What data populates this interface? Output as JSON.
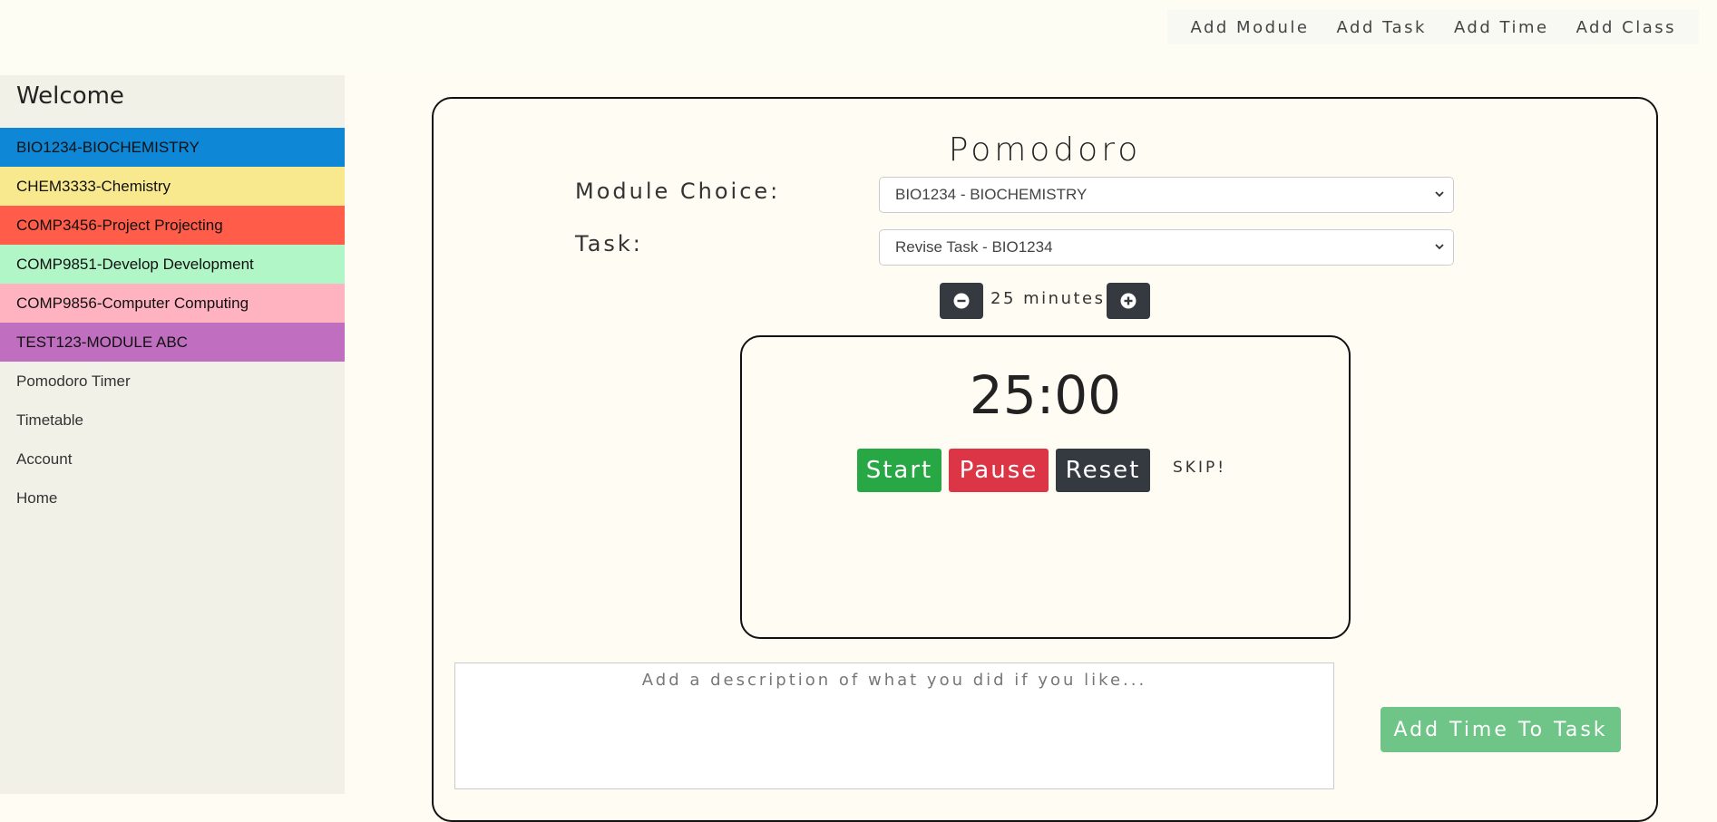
{
  "topnav": {
    "links": [
      "Add Module",
      "Add Task",
      "Add Time",
      "Add Class"
    ]
  },
  "sidebar": {
    "title": "Welcome",
    "modules": [
      {
        "label": "BIO1234-BIOCHEMISTRY",
        "color": "#0d87d6"
      },
      {
        "label": "CHEM3333-Chemistry",
        "color": "#f8e98f"
      },
      {
        "label": "COMP3456-Project Projecting",
        "color": "#ff5c4a"
      },
      {
        "label": "COMP9851-Develop Development",
        "color": "#b0f6c7"
      },
      {
        "label": "COMP9856-Computer Computing",
        "color": "#ffb3c0"
      },
      {
        "label": "TEST123-MODULE ABC",
        "color": "#c06ebf"
      }
    ],
    "nav": [
      "Pomodoro Timer",
      "Timetable",
      "Account",
      "Home"
    ]
  },
  "pomodoro": {
    "title": "Pomodoro",
    "module_label": "Module Choice:",
    "module_value": "BIO1234 - BIOCHEMISTRY",
    "task_label": "Task:",
    "task_value": "Revise Task - BIO1234",
    "duration_text": "25 minutes",
    "timer": "25:00",
    "start_label": "Start",
    "pause_label": "Pause",
    "reset_label": "Reset",
    "skip_label": "SKIP!",
    "description_placeholder": "Add a description of what you did if you like...",
    "add_time_label": "Add Time To Task"
  },
  "colors": {
    "start": "#28a745",
    "pause": "#dc3545",
    "reset": "#343a40",
    "add_time": "#6fc587"
  }
}
